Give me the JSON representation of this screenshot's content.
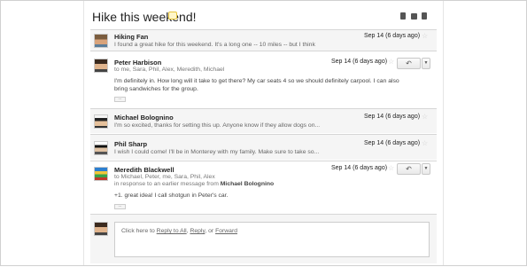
{
  "thread": {
    "subject": "Hike this weekend!",
    "label_icon": "label-icon",
    "toolbar_icons": [
      "expand-all-icon",
      "print-icon",
      "new-window-icon"
    ]
  },
  "messages": [
    {
      "sender": "Hiking Fan",
      "snippet": "I found a great hike for this weekend. It's a long one -- 10 miles -- but I think",
      "date": "Sep 14 (6 days ago)",
      "state": "collapsed",
      "avatar": "hiking-fan-avatar"
    },
    {
      "sender": "Peter Harbison",
      "recipients": "to me, Sara, Phil, Alex, Meredith, Michael",
      "body": "I'm definitely in.  How long will it take to get there?  My car seats 4 so we should definitely carpool.  I can also bring sandwiches for the group.",
      "date": "Sep 14 (6 days ago)",
      "state": "expanded",
      "avatar": "peter-harbison-avatar",
      "ellipsis": "..."
    },
    {
      "sender": "Michael Bolognino",
      "snippet": "I'm so excited, thanks for setting this up. Anyone know if they allow dogs on...",
      "date": "Sep 14 (6 days ago)",
      "state": "collapsed",
      "avatar": "michael-bolognino-avatar"
    },
    {
      "sender": "Phil Sharp",
      "snippet": "I wish I could come!  I'll be in Monterey with my family.  Make sure to take so...",
      "date": "Sep 14 (6 days ago)",
      "state": "collapsed",
      "avatar": "phil-sharp-avatar"
    },
    {
      "sender": "Meredith Blackwell",
      "recipients": "to Michael, Peter, me, Sara, Phil, Alex",
      "in_response_prefix": "in response to an earlier message from",
      "in_response_name": "Michael Bolognino",
      "body": "+1. great idea! I call shotgun in Peter's car.",
      "date": "Sep 14 (6 days ago)",
      "state": "expanded",
      "avatar": "meredith-blackwell-avatar",
      "ellipsis": "..."
    }
  ],
  "reply_box": {
    "prefix": "Click here to",
    "reply_all": "Reply to All",
    "sep1": ",",
    "reply": "Reply",
    "sep2": ", or",
    "forward": "Forward"
  },
  "buttons": {
    "reply_glyph": "↶",
    "more_glyph": "▼",
    "star_glyph": "☆"
  }
}
